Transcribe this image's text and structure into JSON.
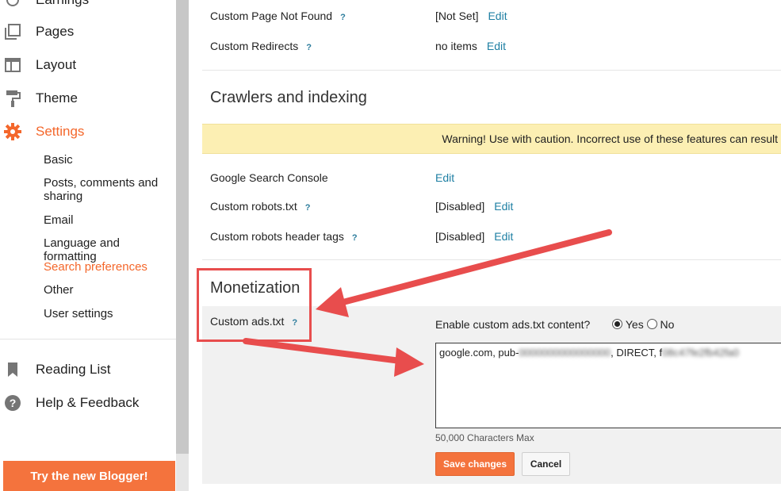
{
  "sidebar": {
    "items": [
      {
        "label": "Earnings",
        "icon": "dollar-icon"
      },
      {
        "label": "Pages",
        "icon": "pages-icon"
      },
      {
        "label": "Layout",
        "icon": "layout-icon"
      },
      {
        "label": "Theme",
        "icon": "paint-roller-icon"
      },
      {
        "label": "Settings",
        "icon": "gear-icon"
      }
    ],
    "sub_items": [
      {
        "label": "Basic"
      },
      {
        "label": "Posts, comments and sharing"
      },
      {
        "label": "Email"
      },
      {
        "label": "Language and formatting"
      },
      {
        "label": "Search preferences"
      },
      {
        "label": "Other"
      },
      {
        "label": "User settings"
      }
    ],
    "bottom_items": [
      {
        "label": "Reading List",
        "icon": "bookmark-icon"
      },
      {
        "label": "Help & Feedback",
        "icon": "help-icon"
      }
    ],
    "try_button": "Try the new Blogger!",
    "active_color": "#f4672b"
  },
  "errors": {
    "custom_page_not_found": {
      "label": "Custom Page Not Found",
      "help": "?",
      "value": "[Not Set]",
      "edit": "Edit"
    },
    "custom_redirects": {
      "label": "Custom Redirects",
      "help": "?",
      "value": "no items",
      "edit": "Edit"
    }
  },
  "crawlers": {
    "title": "Crawlers and indexing",
    "warning": "Warning! Use with caution. Incorrect use of these features can result",
    "search_console": {
      "label": "Google Search Console",
      "edit": "Edit"
    },
    "robots_txt": {
      "label": "Custom robots.txt",
      "help": "?",
      "value": "[Disabled]",
      "edit": "Edit"
    },
    "robots_header": {
      "label": "Custom robots header tags",
      "help": "?",
      "value": "[Disabled]",
      "edit": "Edit"
    }
  },
  "monetization": {
    "title": "Monetization",
    "ads_label": "Custom ads.txt",
    "help": "?",
    "enable_question": "Enable custom ads.txt content?",
    "yes": "Yes",
    "no": "No",
    "selected": "Yes",
    "content_prefix": "google.com, pub-",
    "content_pub_blurred": "0000000000000000",
    "content_middle": ", DIRECT, f",
    "content_cert_blurred": "08c47fe2fb42fa0",
    "content_suffix": "",
    "char_limit": "50,000 Characters Max",
    "save": "Save changes",
    "cancel": "Cancel"
  },
  "colors": {
    "accent": "#f4733d",
    "link": "#1e7fa3",
    "warning_bg": "#fcefb3",
    "annotation_red": "#e84d4d"
  }
}
